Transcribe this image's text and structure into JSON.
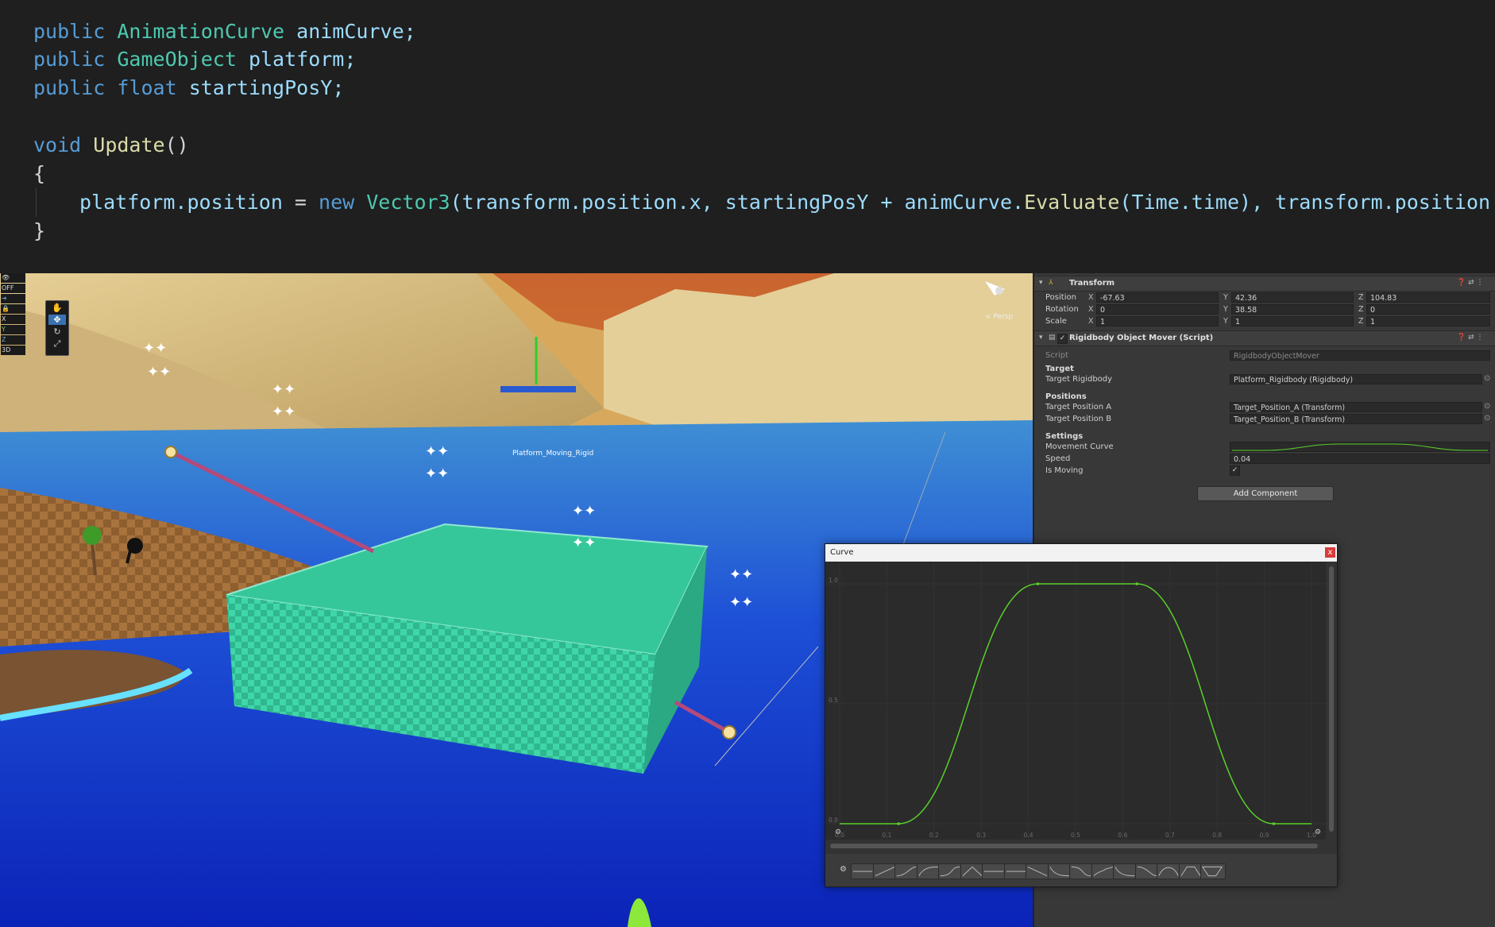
{
  "code": {
    "lines": [
      [
        "public",
        "AnimationCurve",
        "animCurve;"
      ],
      [
        "public",
        "GameObject",
        "platform;"
      ],
      [
        "public",
        "float",
        "startingPosY;"
      ]
    ],
    "method": {
      "kw": "void",
      "name": "Update",
      "parens": "()"
    },
    "open_brace": "{",
    "close_brace": "}",
    "body": {
      "a": "platform.position",
      "b": " = ",
      "c": "new",
      "d": "Vector3",
      "e": "(transform.position.x, startingPosY + animCurve.",
      "f": "Evaluate",
      "g": "(Time.time), transform.position.z);"
    }
  },
  "scene": {
    "left_toolbar": [
      "OFF",
      "X",
      "Y",
      "Z",
      "3D"
    ],
    "gizmo_label": "< Persp",
    "selection_label": "Platform_Moving_Rigid"
  },
  "inspector": {
    "transform": {
      "title": "Transform",
      "rows": [
        {
          "label": "Position",
          "x": "-67.63",
          "y": "42.36",
          "z": "104.83"
        },
        {
          "label": "Rotation",
          "x": "0",
          "y": "38.58",
          "z": "0"
        },
        {
          "label": "Scale",
          "x": "1",
          "y": "1",
          "z": "1"
        }
      ],
      "axes": [
        "X",
        "Y",
        "Z"
      ]
    },
    "mover": {
      "title": "Rigidbody Object Mover (Script)",
      "script_label": "Script",
      "script_value": "RigidbodyObjectMover",
      "section_target": "Target",
      "target_rigidbody_label": "Target Rigidbody",
      "target_rigidbody_value": "Platform_Rigidbody (Rigidbody)",
      "section_positions": "Positions",
      "pos_a_label": "Target Position A",
      "pos_a_value": "Target_Position_A (Transform)",
      "pos_b_label": "Target Position B",
      "pos_b_value": "Target_Position_B (Transform)",
      "section_settings": "Settings",
      "curve_label": "Movement Curve",
      "speed_label": "Speed",
      "speed_value": "0.04",
      "moving_label": "Is Moving",
      "moving_check": "✓"
    },
    "add_component": "Add Component",
    "header_icons": "❓ ⇄ ⋮"
  },
  "curve_window": {
    "title": "Curve",
    "close": "x",
    "y_ticks": [
      "1.0",
      "0.5",
      "0.0"
    ],
    "x_ticks": [
      "0.0",
      "0.1",
      "0.2",
      "0.3",
      "0.4",
      "0.5",
      "0.6",
      "0.7",
      "0.8",
      "0.9",
      "1.0"
    ],
    "curve_color": "#5ad02a",
    "settings_icon": "⚙",
    "curve_keys": [
      [
        0.0,
        0.0
      ],
      [
        0.125,
        0.0
      ],
      [
        0.42,
        1.0
      ],
      [
        0.63,
        1.0
      ],
      [
        0.92,
        0.0
      ],
      [
        1.0,
        0.0
      ]
    ],
    "x_range": [
      0,
      1
    ],
    "y_range": [
      0,
      1
    ]
  }
}
